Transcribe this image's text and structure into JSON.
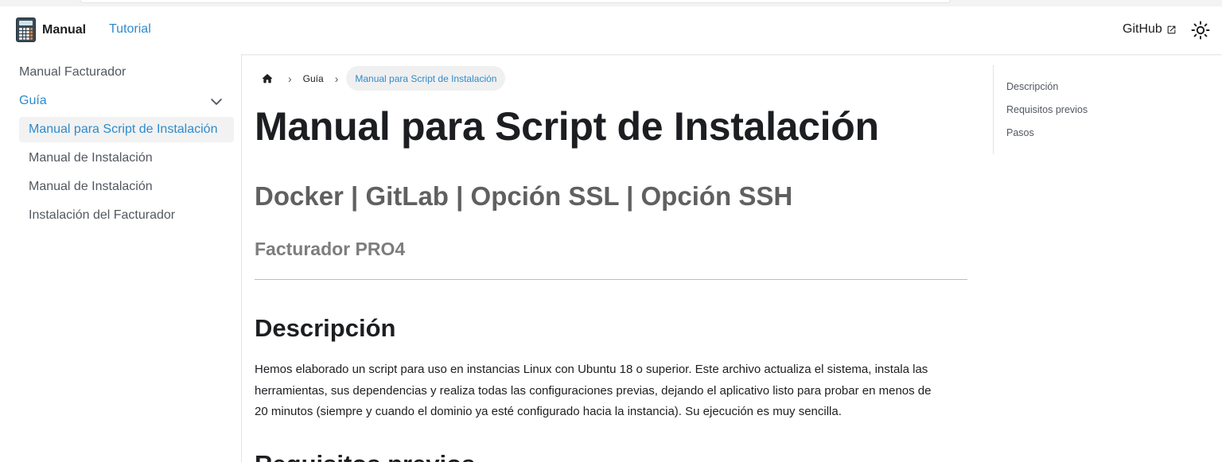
{
  "navbar": {
    "brand_title": "Manual",
    "tutorial_label": "Tutorial",
    "github_label": "GitHub",
    "logo_icon": "calculator-icon",
    "external_icon": "external-link-icon",
    "theme_icon": "sun-icon"
  },
  "sidebar": {
    "category": "Manual Facturador",
    "section": "Guía",
    "items": [
      {
        "label": "Manual para Script de Instalación",
        "active": true
      },
      {
        "label": "Manual de Instalación",
        "active": false
      },
      {
        "label": "Manual de Instalación",
        "active": false
      },
      {
        "label": "Instalación del Facturador",
        "active": false
      }
    ]
  },
  "breadcrumb": {
    "home_icon": "home-icon",
    "items": [
      "Guía",
      "Manual para Script de Instalación"
    ]
  },
  "article": {
    "title": "Manual para Script de Instalación",
    "subtitle": "Docker | GitLab | Opción SSL | Opción SSH",
    "product": "Facturador PRO4",
    "section_heading": "Descripción",
    "paragraph_lines": [
      "Hemos elaborado un script para uso en instancias Linux con Ubuntu 18 o superior. Este archivo actualiza el sistema, instala las",
      "herramientas, sus dependencias y realiza todas las configuraciones previas, dejando el aplicativo listo para probar en menos de",
      "20 minutos (siempre y cuando el dominio ya esté configurado hacia la instancia). Su ejecución es muy sencilla."
    ],
    "next_heading": "Requisitos previos"
  },
  "toc": {
    "items": [
      "Descripción",
      "Requisitos previos",
      "Pasos"
    ]
  },
  "colors": {
    "accent": "#2e8bcc",
    "text": "#1c1e21",
    "muted": "#525860"
  }
}
